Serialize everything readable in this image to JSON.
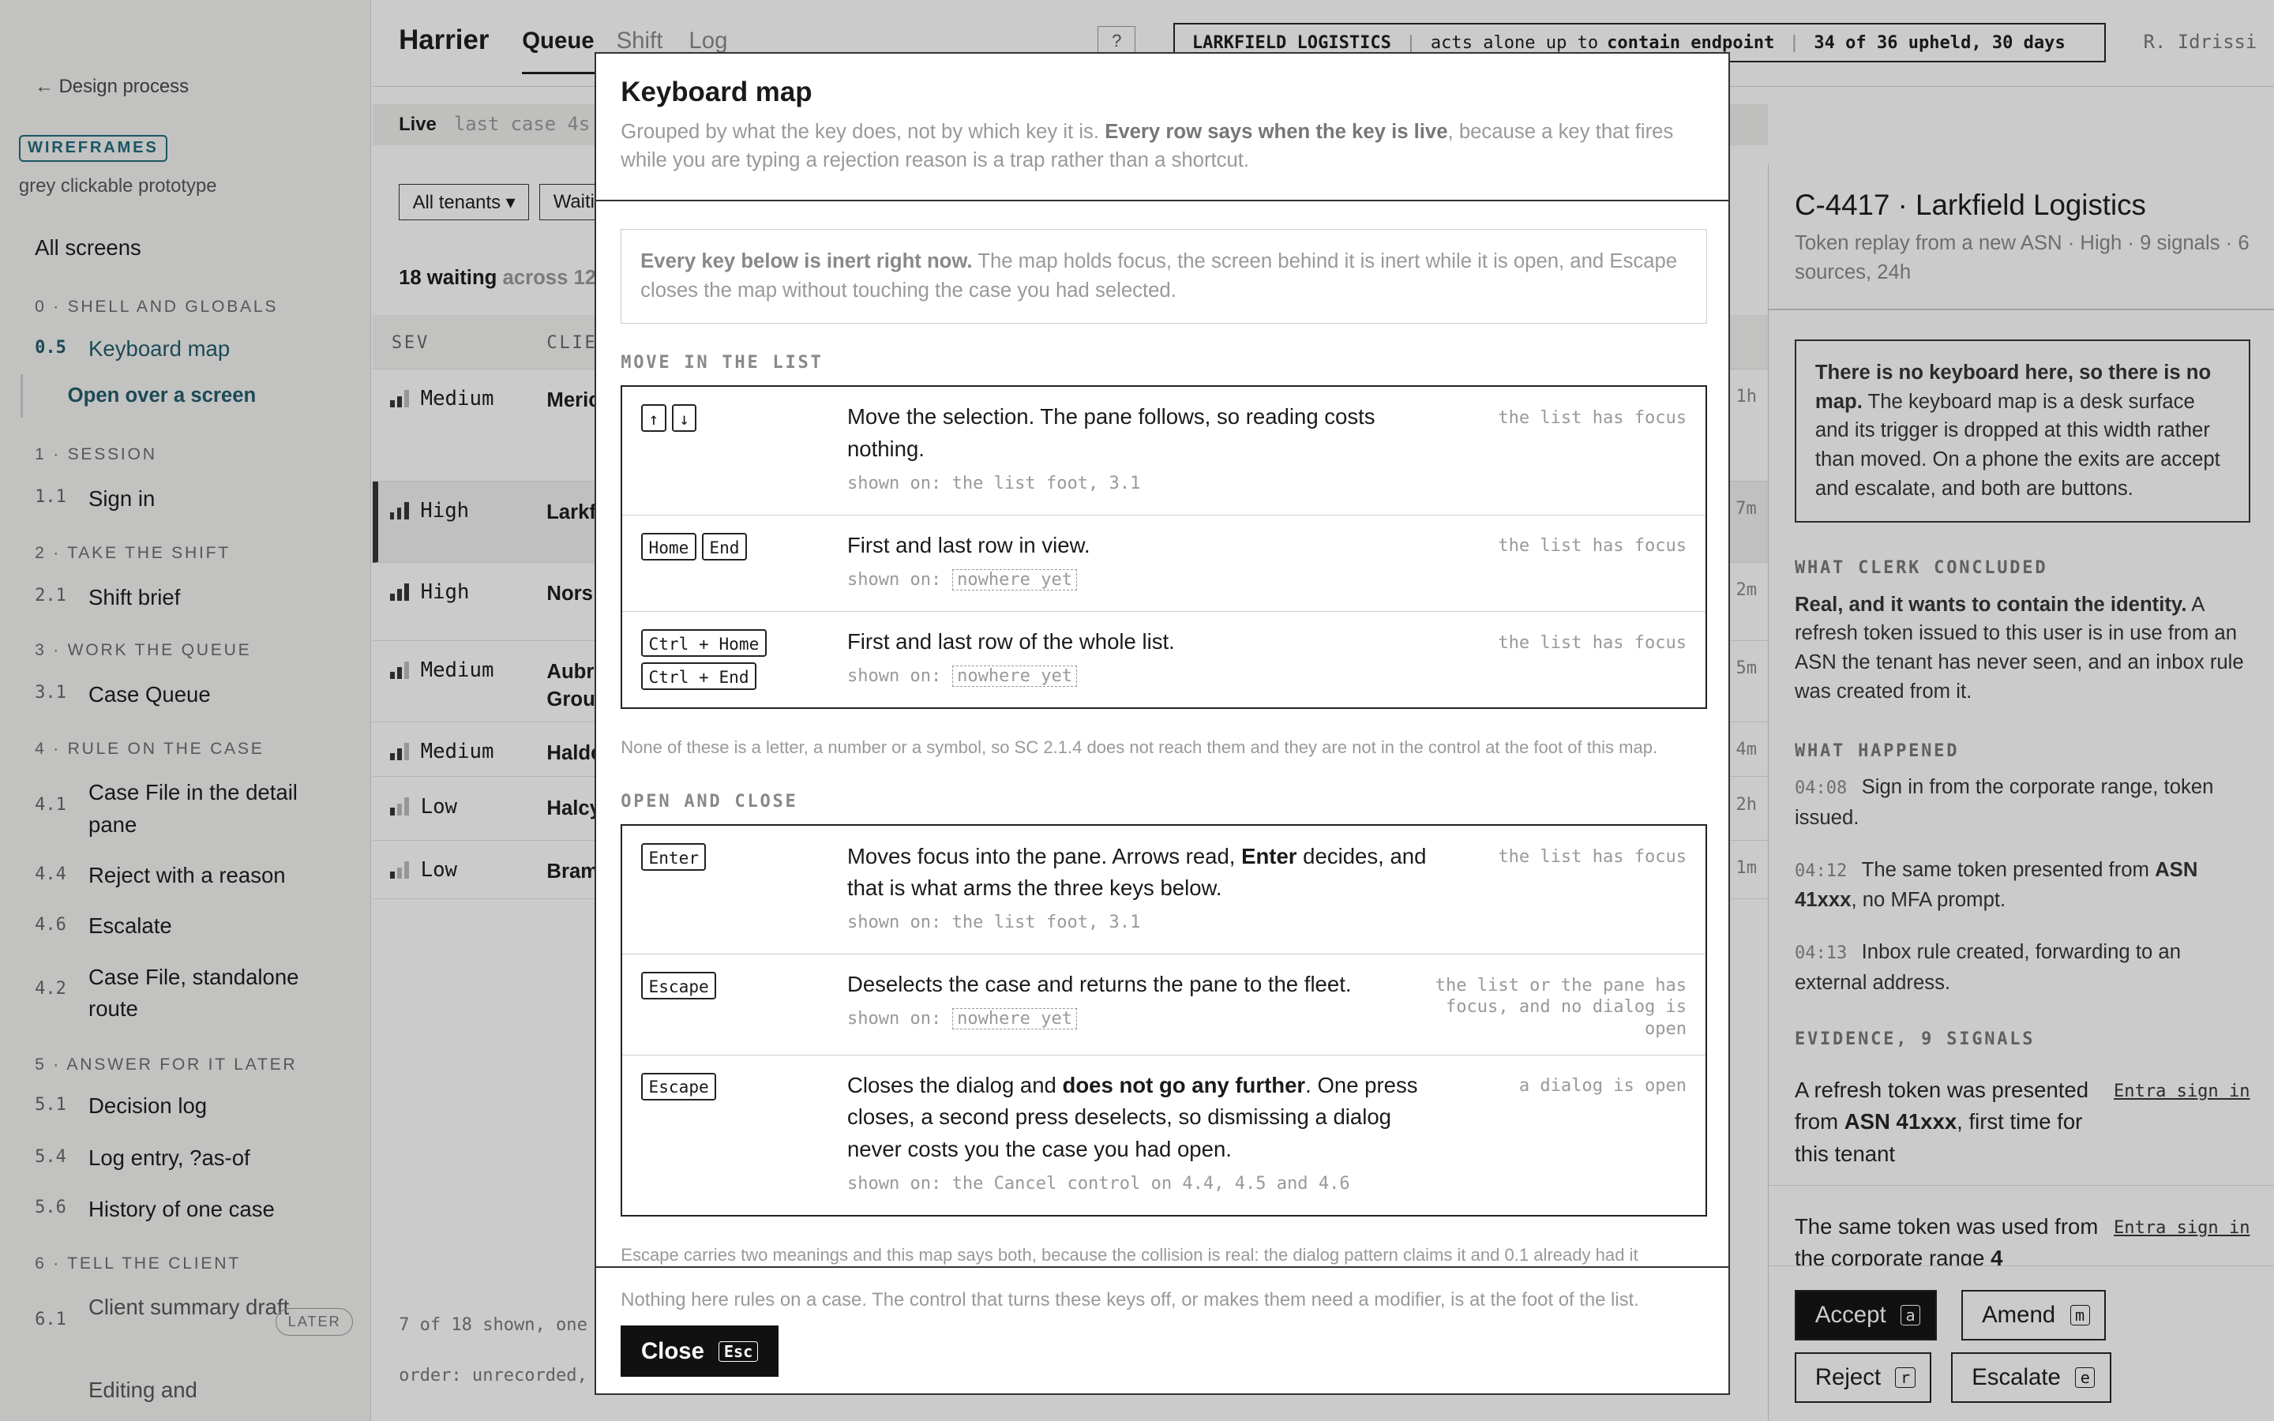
{
  "sidebar": {
    "back": "← Design process",
    "badge": "WIREFRAMES",
    "subtitle": "grey clickable prototype",
    "all_screens": "All screens",
    "sections": [
      {
        "title": "0 · SHELL AND GLOBALS"
      },
      {
        "title": "1 · SESSION"
      },
      {
        "title": "2 · TAKE THE SHIFT"
      },
      {
        "title": "3 · WORK THE QUEUE"
      },
      {
        "title": "4 · RULE ON THE CASE"
      },
      {
        "title": "5 · ANSWER FOR IT LATER"
      },
      {
        "title": "6 · TELL THE CLIENT"
      }
    ],
    "items": [
      {
        "num": "0.5",
        "label": "Keyboard map"
      },
      {
        "num": "1.1",
        "label": "Sign in"
      },
      {
        "num": "2.1",
        "label": "Shift brief"
      },
      {
        "num": "3.1",
        "label": "Case Queue"
      },
      {
        "num": "4.1",
        "label": "Case File in the detail pane"
      },
      {
        "num": "4.4",
        "label": "Reject with a reason"
      },
      {
        "num": "4.6",
        "label": "Escalate"
      },
      {
        "num": "4.2",
        "label": "Case File, standalone route"
      },
      {
        "num": "5.1",
        "label": "Decision log"
      },
      {
        "num": "5.4",
        "label": "Log entry, ?as-of"
      },
      {
        "num": "5.6",
        "label": "History of one case"
      },
      {
        "num": "6.1",
        "label": "Client summary draft"
      },
      {
        "num": "",
        "label": "Editing and"
      }
    ],
    "subitem": "Open over a screen",
    "later": "LATER"
  },
  "header": {
    "brand": "Harrier",
    "tabs": [
      "Queue",
      "Shift",
      "Log"
    ],
    "help": "?",
    "tenant": "LARKFIELD LOGISTICS",
    "tenant_policy_pre": "acts alone up to ",
    "tenant_policy_bold": "contain endpoint",
    "tenant_stat": "34 of 36 upheld, 30 days",
    "user": "R. Idrissi"
  },
  "queue": {
    "live": "Live",
    "live_meta": "last case 4s",
    "filter_tenants": "All tenants ▾",
    "filter_waiting": "Waiti",
    "waiting_bold": "18 waiting",
    "waiting_rest": " across 12",
    "col_sev": "SEV",
    "col_client": "CLIE",
    "rows": [
      {
        "sev": "Medium",
        "client": "Meric",
        "ago": "1h"
      },
      {
        "sev": "High",
        "client": "Larkf",
        "ago": "7m"
      },
      {
        "sev": "High",
        "client": "Nors",
        "ago": "2m"
      },
      {
        "sev": "Medium",
        "client": "Aubr Grou",
        "ago": "5m"
      },
      {
        "sev": "Medium",
        "client": "Halde",
        "ago": "4m"
      },
      {
        "sev": "Low",
        "client": "Halcy",
        "ago": "2h"
      },
      {
        "sev": "Low",
        "client": "Bram",
        "ago": "1m"
      }
    ],
    "foot1": "7 of 18 shown, one",
    "foot2": "order: unrecorded,"
  },
  "pane": {
    "title": "C-4417 · Larkfield Logistics",
    "meta": "Token replay from a new ASN · High · 9 signals · 6 sources, 24h",
    "nokb_bold": "There is no keyboard here, so there is no map.",
    "nokb_rest": " The keyboard map is a desk surface and its trigger is dropped at this width rather than moved. On a phone the exits are accept and escalate, and both are buttons.",
    "concluded_label": "WHAT CLERK CONCLUDED",
    "concluded_bold": "Real, and it wants to contain the identity.",
    "concluded_rest": " A refresh token issued to this user is in use from an ASN the tenant has never seen, and an inbox rule was created from it.",
    "happened_label": "WHAT HAPPENED",
    "events": [
      {
        "t": "04:08",
        "text": "Sign in from the corporate range, token issued."
      },
      {
        "t": "04:12",
        "text_pre": "The same token presented from ",
        "bold": "ASN 41xxx",
        "text_post": ", no MFA prompt."
      },
      {
        "t": "04:13",
        "text": "Inbox rule created, forwarding to an external address."
      }
    ],
    "evidence_label": "EVIDENCE, 9 SIGNALS",
    "signals": [
      {
        "pre": "A refresh token was presented from ",
        "bold": "ASN 41xxx",
        "post": ", first time for this tenant",
        "source": "Entra sign in"
      },
      {
        "pre": "The same token was used from the corporate range ",
        "bold": "4",
        "post": "",
        "source": "Entra sign in"
      }
    ],
    "actions": [
      {
        "label": "Accept",
        "key": "a"
      },
      {
        "label": "Amend",
        "key": "m"
      },
      {
        "label": "Reject",
        "key": "r"
      },
      {
        "label": "Escalate",
        "key": "e"
      }
    ]
  },
  "modal": {
    "title": "Keyboard map",
    "intro_pre": "Grouped by what the key does, not by which key it is. ",
    "intro_bold": "Every row says when the key is live",
    "intro_post": ", because a key that fires while you are typing a rejection reason is a trap rather than a shortcut.",
    "inert_bold": "Every key below is inert right now.",
    "inert_rest": " The map holds focus, the screen behind it is inert while it is open, and Escape closes the map without touching the case you had selected.",
    "group1": {
      "title": "MOVE IN THE LIST",
      "rows": [
        {
          "keys": [
            "↑",
            "↓"
          ],
          "desc": "Move the selection. The pane follows, so reading costs nothing.",
          "shown_pre": "shown on: ",
          "shown": "the list foot, 3.1",
          "dashed": false,
          "when": "the list has focus"
        },
        {
          "keys": [
            "Home",
            "End"
          ],
          "desc": "First and last row in view.",
          "shown_pre": "shown on: ",
          "shown": "nowhere yet",
          "dashed": true,
          "when": "the list has focus"
        },
        {
          "keys": [
            "Ctrl + Home",
            "Ctrl + End"
          ],
          "desc": "First and last row of the whole list.",
          "shown_pre": "shown on: ",
          "shown": "nowhere yet",
          "dashed": true,
          "when": "the list has focus"
        }
      ],
      "note": "None of these is a letter, a number or a symbol, so SC 2.1.4 does not reach them and they are not in the control at the foot of this map."
    },
    "group2": {
      "title": "OPEN AND CLOSE",
      "rows": [
        {
          "keys": [
            "Enter"
          ],
          "desc_pre": "Moves focus into the pane. Arrows read, ",
          "desc_bold": "Enter",
          "desc_post": " decides, and that is what arms the three keys below.",
          "shown_pre": "shown on: ",
          "shown": "the list foot, 3.1",
          "dashed": false,
          "when": "the list has focus"
        },
        {
          "keys": [
            "Escape"
          ],
          "desc_pre": "Deselects the case and returns the pane to the fleet.",
          "desc_bold": "",
          "desc_post": "",
          "shown_pre": "shown on: ",
          "shown": "nowhere yet",
          "dashed": true,
          "when": "the list or the pane has focus, and no dialog is open"
        },
        {
          "keys": [
            "Escape"
          ],
          "desc_pre": "Closes the dialog and ",
          "desc_bold": "does not go any further",
          "desc_post": ". One press closes, a second press deselects, so dismissing a dialog never costs you the case you had open.",
          "shown_pre": "shown on: ",
          "shown": "the Cancel control on 4.4, 4.5 and 4.6",
          "dashed": false,
          "when": "a dialog is open"
        }
      ],
      "note": "Escape carries two meanings and this map says both, because the collision is real: the dialog pattern claims it and 0.1 already had it"
    },
    "footer_note": "Nothing here rules on a case. The control that turns these keys off, or makes them need a modifier, is at the foot of the list.",
    "close_label": "Close",
    "close_key": "Esc"
  }
}
